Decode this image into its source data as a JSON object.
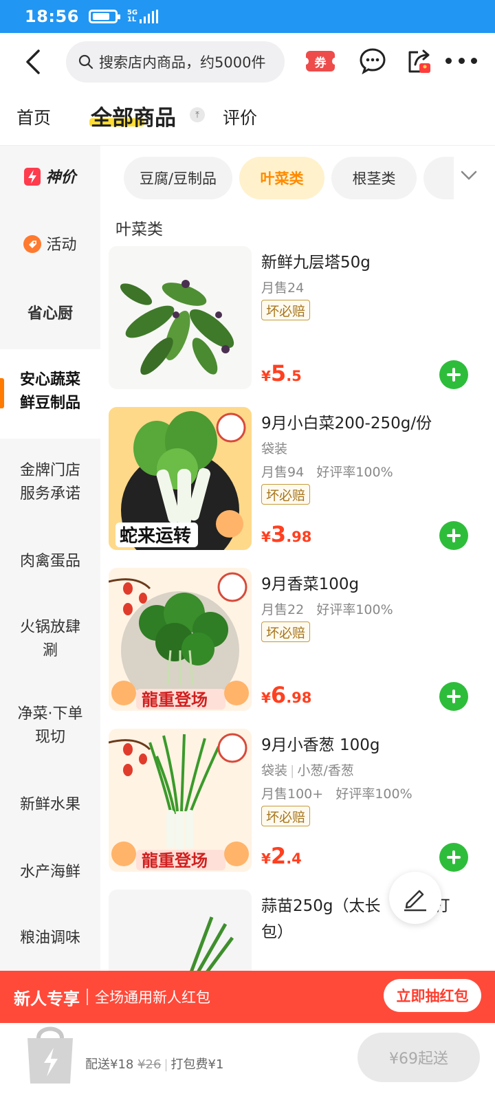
{
  "status_bar": {
    "time": "18:56",
    "network": "5G",
    "network_sub": "1L"
  },
  "search": {
    "placeholder": "搜索店内商品，约5000件"
  },
  "toolbar": {
    "coupon_label": "券"
  },
  "tabs": [
    {
      "label": "首页"
    },
    {
      "label": "全部商品",
      "active": true
    },
    {
      "label": "评价"
    }
  ],
  "sidebar": {
    "items": [
      {
        "label": "神价"
      },
      {
        "label": "活动"
      },
      {
        "label": "省心厨"
      },
      {
        "label": "安心蔬菜鲜豆制品",
        "line1": "安心蔬菜",
        "line2": "鲜豆制品",
        "active": true
      },
      {
        "label": "金牌门店服务承诺",
        "line1": "金牌门店",
        "line2": "服务承诺"
      },
      {
        "label": "肉禽蛋品"
      },
      {
        "label": "火锅放肆涮",
        "line1": "火锅放肆",
        "line2": "涮"
      },
      {
        "label": "净菜·下单现切",
        "line1": "净菜·下单",
        "line2": "现切"
      },
      {
        "label": "新鲜水果"
      },
      {
        "label": "水产海鲜"
      },
      {
        "label": "粮油调味"
      }
    ]
  },
  "chips": [
    {
      "label": "豆腐/豆制品"
    },
    {
      "label": "叶菜类",
      "active": true
    },
    {
      "label": "根茎类"
    }
  ],
  "section_title": "叶菜类",
  "products": [
    {
      "name": "新鲜九层塔50g",
      "spec": "",
      "sales": "月售24",
      "rating": "",
      "tag": "坏必赔",
      "price_symbol": "¥",
      "price_int": "5",
      "price_dec": ".5"
    },
    {
      "name": "9月小白菜200-250g/份",
      "spec": "袋装",
      "sales": "月售94",
      "rating": "好评率100%",
      "tag": "坏必赔",
      "price_symbol": "¥",
      "price_int": "3",
      "price_dec": ".98",
      "banner_text": "蛇来运转"
    },
    {
      "name": "9月香菜100g",
      "spec": "",
      "sales": "月售22",
      "rating": "好评率100%",
      "tag": "坏必赔",
      "price_symbol": "¥",
      "price_int": "6",
      "price_dec": ".98",
      "banner_text": "龍重登场"
    },
    {
      "name": "9月小香葱 100g",
      "spec": "袋装",
      "spec2": "小葱/香葱",
      "sales": "月售100+",
      "rating": "好评率100%",
      "tag": "坏必赔",
      "price_symbol": "¥",
      "price_int": "2",
      "price_dec": ".4",
      "banner_text": "龍重登场"
    },
    {
      "name": "蒜苗250g（太长",
      "name_tail": "打",
      "name_line2": "包）"
    }
  ],
  "promo": {
    "title": "新人专享",
    "subtitle": "全场通用新人红包",
    "button": "立即抽红包"
  },
  "bottom": {
    "delivery_prefix": "配送",
    "delivery_fee": "¥18",
    "delivery_original": "¥26",
    "packing": "打包费¥1",
    "checkout": "¥69起送"
  },
  "colors": {
    "status_bar": "#2196f3",
    "accent_orange": "#ff8a00",
    "price_red": "#ff4020",
    "add_green": "#2ebd3b",
    "promo_red": "#ff4a3a"
  }
}
